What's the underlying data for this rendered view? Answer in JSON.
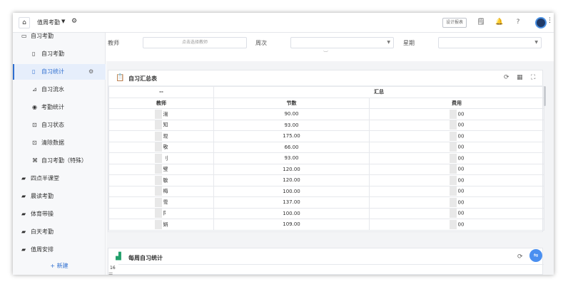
{
  "topbar": {
    "home_icon": "home-icon",
    "title": "值周考勤",
    "caret": "▼",
    "design_report": "设计报表",
    "icons": [
      "document-icon",
      "bell-icon",
      "help-icon"
    ]
  },
  "sidebar": {
    "items": [
      {
        "label": "自习考勤",
        "icon": "📂",
        "level": 0
      },
      {
        "label": "自习考勤",
        "icon": "🗎",
        "level": 1
      },
      {
        "label": "自习统计",
        "icon": "🗎",
        "level": 1,
        "active": true
      },
      {
        "label": "自习流水",
        "icon": "⊿",
        "level": 1
      },
      {
        "label": "考勤统计",
        "icon": "⊕",
        "level": 1
      },
      {
        "label": "自习状态",
        "icon": "⊡",
        "level": 1
      },
      {
        "label": "清除数据",
        "icon": "⊡",
        "level": 1
      },
      {
        "label": "自习考勤（特殊）",
        "icon": "⌘",
        "level": 1
      },
      {
        "label": "四点半课堂",
        "icon": "▰",
        "level": 0
      },
      {
        "label": "晨读考勤",
        "icon": "▰",
        "level": 0
      },
      {
        "label": "体育带操",
        "icon": "▰",
        "level": 0
      },
      {
        "label": "白天考勤",
        "icon": "▰",
        "level": 0
      },
      {
        "label": "值周安排",
        "icon": "▰",
        "level": 0
      }
    ],
    "new_label": "+ 新建"
  },
  "filters": {
    "teacher_label": "教师",
    "teacher_placeholder": "点击选择教师",
    "week_label": "周次",
    "weekday_label": "星期"
  },
  "summary": {
    "title": "自习汇总表",
    "header_top_left": "--",
    "header_top_right": "汇总",
    "columns": [
      "教师",
      "节数",
      "费用"
    ],
    "rows": [
      {
        "teacher": "湍",
        "count": "90.00",
        "fee": "00"
      },
      {
        "teacher": "知",
        "count": "93.00",
        "fee": "00"
      },
      {
        "teacher": "现",
        "count": "175.00",
        "fee": "00"
      },
      {
        "teacher": "敬",
        "count": "66.00",
        "fee": "00"
      },
      {
        "teacher": "刂",
        "count": "93.00",
        "fee": "00"
      },
      {
        "teacher": "璧",
        "count": "120.00",
        "fee": "00"
      },
      {
        "teacher": "敏",
        "count": "120.00",
        "fee": "00"
      },
      {
        "teacher": "梅",
        "count": "100.00",
        "fee": "00"
      },
      {
        "teacher": "雪",
        "count": "137.00",
        "fee": "00"
      },
      {
        "teacher": "阝",
        "count": "100.00",
        "fee": "00"
      },
      {
        "teacher": "娟",
        "count": "109.00",
        "fee": "00"
      }
    ]
  },
  "weekly": {
    "title": "每周自习统计",
    "axis_top": "16"
  }
}
